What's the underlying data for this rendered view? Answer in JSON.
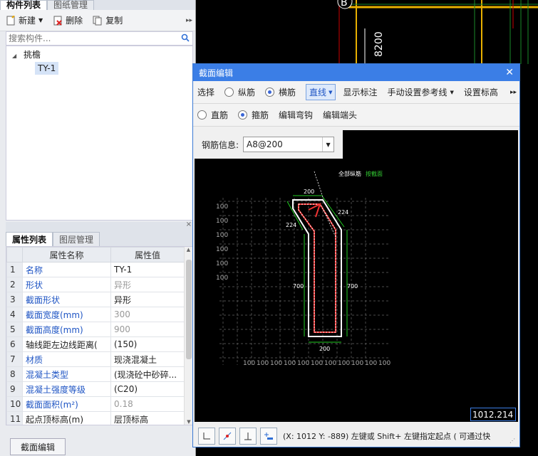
{
  "left": {
    "tabs": [
      "构件列表",
      "图纸管理"
    ],
    "toolbar": {
      "new": "新建",
      "delete": "删除",
      "copy": "复制"
    },
    "search_placeholder": "搜索构件...",
    "tree": {
      "root": "挑檐",
      "child": "TY-1"
    },
    "prop_tabs": [
      "属性列表",
      "图层管理"
    ],
    "prop_headers": {
      "name": "属性名称",
      "value": "属性值"
    },
    "props": [
      {
        "n": "1",
        "name": "名称",
        "value": "TY-1",
        "name_blue": true,
        "value_gray": false
      },
      {
        "n": "2",
        "name": "形状",
        "value": "异形",
        "name_blue": true,
        "value_gray": true
      },
      {
        "n": "3",
        "name": "截面形状",
        "value": "异形",
        "name_blue": true,
        "value_gray": false
      },
      {
        "n": "4",
        "name": "截面宽度(mm)",
        "value": "300",
        "name_blue": true,
        "value_gray": true
      },
      {
        "n": "5",
        "name": "截面高度(mm)",
        "value": "900",
        "name_blue": true,
        "value_gray": true
      },
      {
        "n": "6",
        "name": "轴线距左边线距离(",
        "value": "(150)",
        "name_blue": false,
        "value_gray": false
      },
      {
        "n": "7",
        "name": "材质",
        "value": "现浇混凝土",
        "name_blue": true,
        "value_gray": false
      },
      {
        "n": "8",
        "name": "混凝土类型",
        "value": "(现浇砼中砂碎...",
        "name_blue": true,
        "value_gray": false
      },
      {
        "n": "9",
        "name": "混凝土强度等级",
        "value": "(C20)",
        "name_blue": true,
        "value_gray": false
      },
      {
        "n": "10",
        "name": "截面面积(m²)",
        "value": "0.18",
        "name_blue": true,
        "value_gray": true
      },
      {
        "n": "11",
        "name": "起点顶标高(m)",
        "value": "层顶标高",
        "name_blue": false,
        "value_gray": false
      }
    ],
    "section_edit_button": "截面编辑"
  },
  "top_canvas": {
    "axis_label": "B",
    "dim_text": "8200"
  },
  "dialog": {
    "title": "截面编辑",
    "row1": {
      "select": "选择",
      "longitudinal": "纵筋",
      "transverse": "横筋",
      "line": "直线",
      "show_annotation": "显示标注",
      "manual_ref": "手动设置参考线",
      "set_elevation": "设置标高"
    },
    "row2": {
      "straight": "直筋",
      "stirrup": "箍筋",
      "edit_hook": "编辑弯钩",
      "edit_end": "编辑端头"
    },
    "rebar_info_label": "钢筋信息:",
    "rebar_value": "A8@200",
    "drawing": {
      "top_label_a": "全部纵筋",
      "top_label_b": "按截面",
      "dims": [
        "200",
        "224",
        "224",
        "700",
        "700",
        "200"
      ],
      "grid_labels": [
        "100",
        "100",
        "100",
        "100",
        "100",
        "100",
        "100",
        "100",
        "100",
        "100",
        "100"
      ]
    },
    "coord_value": "1012.214",
    "status_text": "(X: 1012 Y: -889)  左键或 Shift+ 左键指定起点 ( 可通过快"
  }
}
